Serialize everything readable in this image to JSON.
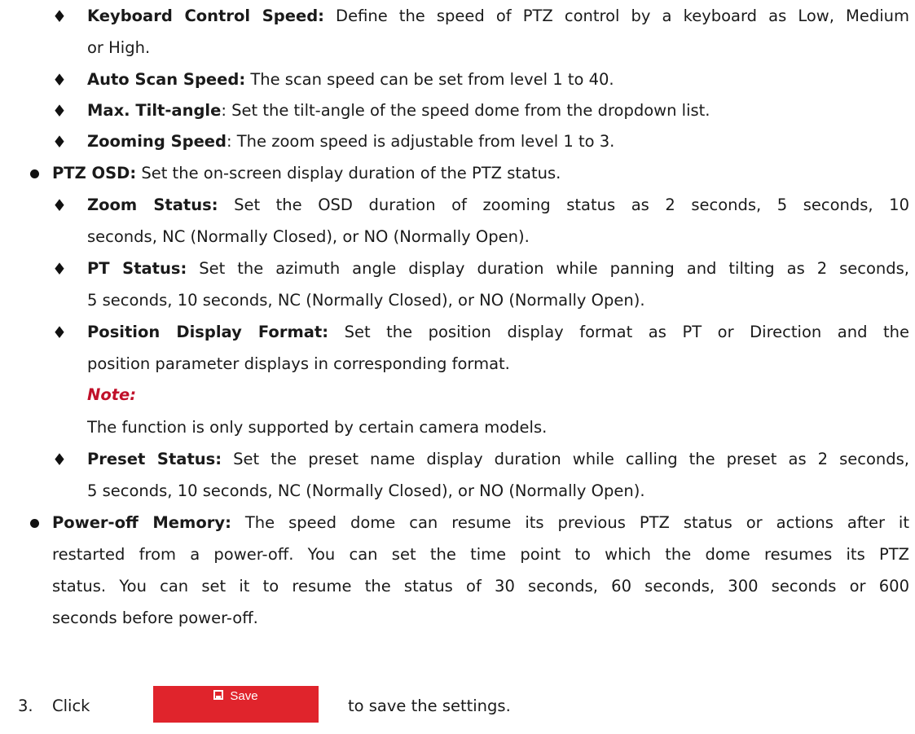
{
  "bullets": {
    "diamond": "♦"
  },
  "keyboard_control_speed": {
    "term": "Keyboard Control Speed:",
    "line1": " Define the speed of PTZ control by a keyboard as Low, Medium",
    "line2": "or High."
  },
  "auto_scan_speed": {
    "term": "Auto Scan Speed:",
    "text": " The scan speed can be set from level 1 to 40."
  },
  "max_tilt_angle": {
    "term": "Max. Tilt-angle",
    "text": ": Set the tilt-angle of the speed dome from the dropdown list."
  },
  "zooming_speed": {
    "term": "Zooming Speed",
    "text": ": The zoom speed is adjustable from level 1 to 3."
  },
  "ptz_osd": {
    "term": "PTZ OSD:",
    "text": " Set the on-screen display duration of the PTZ status."
  },
  "zoom_status": {
    "term": "Zoom Status:",
    "line1": " Set the OSD duration of zooming status as 2 seconds, 5 seconds, 10",
    "line2": "seconds, NC (Normally Closed), or NO (Normally Open)."
  },
  "pt_status": {
    "term": "PT Status:",
    "line1": " Set the azimuth angle display duration while panning and tilting as 2 seconds,",
    "line2": "5 seconds, 10 seconds, NC (Normally Closed), or NO (Normally Open)."
  },
  "position_display_format": {
    "term": "Position Display Format:",
    "line1": " Set the position display format as PT or Direction and the",
    "line2": "position parameter displays in corresponding format."
  },
  "note": {
    "label": "Note:",
    "text": "The function is only supported by certain camera models."
  },
  "preset_status": {
    "term": "Preset Status:",
    "line1": " Set the preset name display duration while calling the preset as 2 seconds,",
    "line2": "5 seconds, 10 seconds, NC (Normally Closed), or NO (Normally Open)."
  },
  "power_off_memory": {
    "term": "Power-off Memory:",
    "line1": " The speed dome can resume its previous PTZ status or actions after it",
    "line2": "restarted from a power-off. You can set the time point to which the dome resumes its PTZ",
    "line3": "status. You can set it to resume the status of 30 seconds, 60 seconds, 300 seconds or 600",
    "line4": "seconds before power-off."
  },
  "step3": {
    "number": "3.",
    "before": "Click",
    "after": "to save the settings."
  },
  "save_button": {
    "label": "Save",
    "icon": "floppy-disk-icon",
    "color": "#e0242c"
  }
}
